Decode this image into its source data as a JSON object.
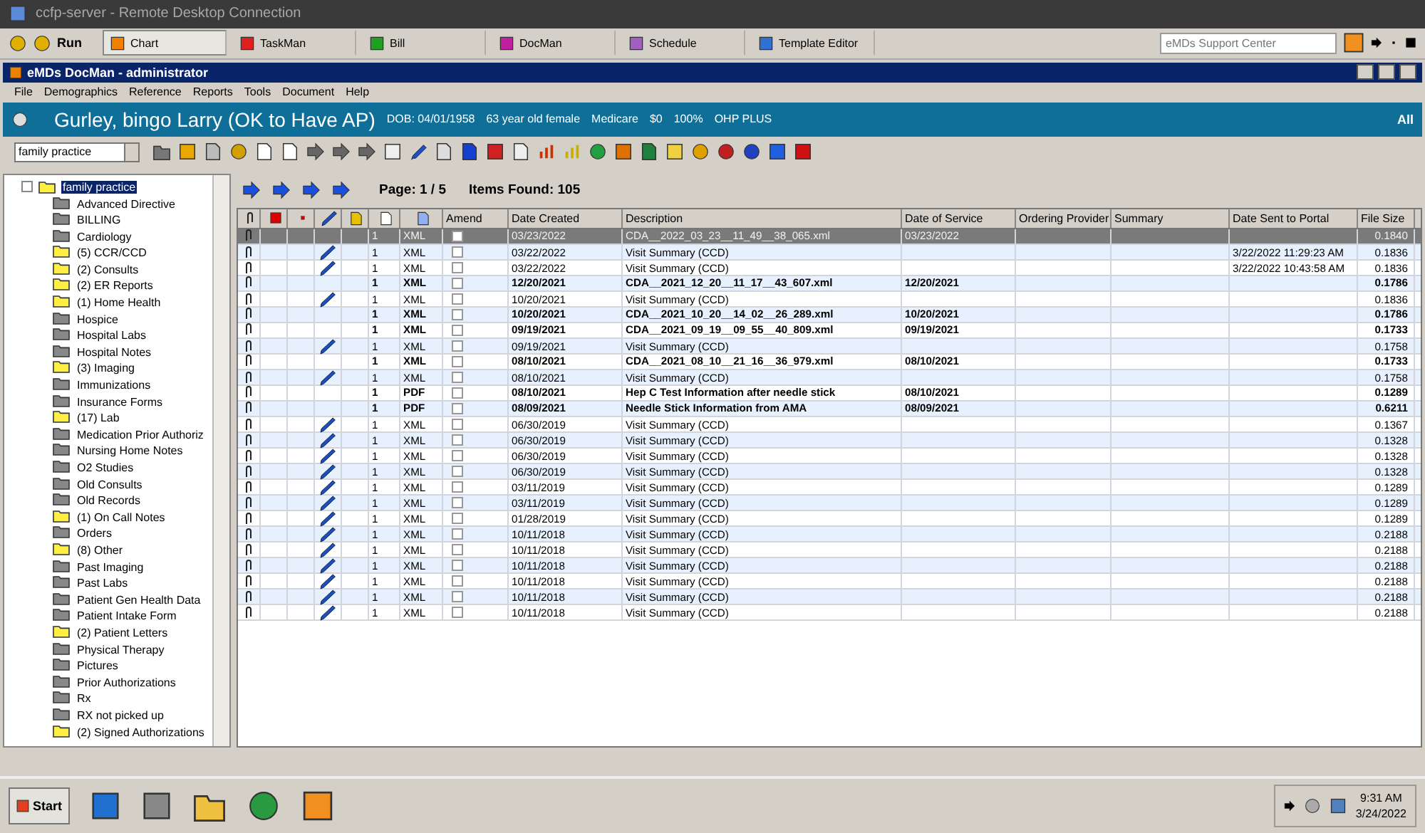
{
  "remote_window": {
    "title": "ccfp-server - Remote Desktop Connection"
  },
  "launcher": {
    "run_label": "Run",
    "tabs": [
      {
        "label": "Chart",
        "selected": true
      },
      {
        "label": "TaskMan",
        "selected": false
      },
      {
        "label": "Bill",
        "selected": false
      },
      {
        "label": "DocMan",
        "selected": false
      },
      {
        "label": "Schedule",
        "selected": false
      },
      {
        "label": "Template Editor",
        "selected": false
      }
    ],
    "search": {
      "placeholder": "eMDs Support Center"
    }
  },
  "window": {
    "title": "eMDs DocMan - administrator"
  },
  "menu": [
    "File",
    "Demographics",
    "Reference",
    "Reports",
    "Tools",
    "Document",
    "Help"
  ],
  "patient": {
    "name": "Gurley, bingo Larry (OK to Have AP)",
    "details": [
      "DOB: 04/01/1958",
      "63 year old female",
      "Medicare",
      "$0",
      "100%",
      "OHP PLUS"
    ],
    "filter": "All"
  },
  "toolbar": {
    "category": "family practice"
  },
  "tree": {
    "label": "family practice",
    "selected": true,
    "expanded": true,
    "children": [
      {
        "label": "Advanced Directive",
        "has_items": false
      },
      {
        "label": "BILLING",
        "has_items": false
      },
      {
        "label": "Cardiology",
        "has_items": false
      },
      {
        "label": "(5)  CCR/CCD",
        "has_items": true
      },
      {
        "label": "(2)  Consults",
        "has_items": true
      },
      {
        "label": "(2)  ER Reports",
        "has_items": true
      },
      {
        "label": "(1)  Home Health",
        "has_items": true
      },
      {
        "label": "Hospice",
        "has_items": false
      },
      {
        "label": "Hospital Labs",
        "has_items": false
      },
      {
        "label": "Hospital Notes",
        "has_items": false
      },
      {
        "label": "(3)  Imaging",
        "has_items": true
      },
      {
        "label": "Immunizations",
        "has_items": false
      },
      {
        "label": "Insurance Forms",
        "has_items": false
      },
      {
        "label": "(17)  Lab",
        "has_items": true
      },
      {
        "label": "Medication Prior Authoriz",
        "has_items": false
      },
      {
        "label": "Nursing Home Notes",
        "has_items": false
      },
      {
        "label": "O2 Studies",
        "has_items": false
      },
      {
        "label": "Old Consults",
        "has_items": false
      },
      {
        "label": "Old Records",
        "has_items": false
      },
      {
        "label": "(1)  On Call Notes",
        "has_items": true
      },
      {
        "label": "Orders",
        "has_items": false
      },
      {
        "label": "(8)  Other",
        "has_items": true
      },
      {
        "label": "Past Imaging",
        "has_items": false
      },
      {
        "label": "Past Labs",
        "has_items": false
      },
      {
        "label": "Patient Gen Health Data",
        "has_items": false
      },
      {
        "label": "Patient Intake Form",
        "has_items": false
      },
      {
        "label": "(2)  Patient Letters",
        "has_items": true
      },
      {
        "label": "Physical Therapy",
        "has_items": false
      },
      {
        "label": "Pictures",
        "has_items": false
      },
      {
        "label": "Prior Authorizations",
        "has_items": false
      },
      {
        "label": "Rx",
        "has_items": false
      },
      {
        "label": "RX not picked up",
        "has_items": false
      },
      {
        "label": "(2)  Signed Authorizations",
        "has_items": true
      }
    ]
  },
  "pager": {
    "page": "Page: 1 / 5",
    "found": "Items Found: 105"
  },
  "table": {
    "columns": [
      "Amend",
      "Date Created",
      "Description",
      "Date of Service",
      "Ordering Provider",
      "Summary",
      "Date Sent to Portal",
      "File Size"
    ],
    "rows": [
      {
        "selected": true,
        "bold": false,
        "edited": false,
        "count": "1",
        "format": "XML",
        "amend": false,
        "date_created": "03/23/2022",
        "description": "CDA__2022_03_23__11_49__38_065.xml",
        "date_of_service": "03/23/2022",
        "file_size": "0.1840"
      },
      {
        "selected": false,
        "bold": false,
        "edited": true,
        "count": "1",
        "format": "XML",
        "amend": false,
        "date_created": "03/22/2022",
        "description": "Visit Summary (CCD)",
        "date_sent": "3/22/2022 11:29:23 AM",
        "file_size": "0.1836"
      },
      {
        "selected": false,
        "bold": false,
        "edited": true,
        "count": "1",
        "format": "XML",
        "amend": false,
        "date_created": "03/22/2022",
        "description": "Visit Summary (CCD)",
        "date_sent": "3/22/2022 10:43:58 AM",
        "file_size": "0.1836"
      },
      {
        "selected": false,
        "bold": true,
        "edited": false,
        "count": "1",
        "format": "XML",
        "amend": false,
        "date_created": "12/20/2021",
        "description": "CDA__2021_12_20__11_17__43_607.xml",
        "date_of_service": "12/20/2021",
        "file_size": "0.1786"
      },
      {
        "selected": false,
        "bold": false,
        "edited": true,
        "count": "1",
        "format": "XML",
        "amend": false,
        "date_created": "10/20/2021",
        "description": "Visit Summary (CCD)",
        "file_size": "0.1836"
      },
      {
        "selected": false,
        "bold": true,
        "edited": false,
        "count": "1",
        "format": "XML",
        "amend": false,
        "date_created": "10/20/2021",
        "description": "CDA__2021_10_20__14_02__26_289.xml",
        "date_of_service": "10/20/2021",
        "file_size": "0.1786"
      },
      {
        "selected": false,
        "bold": true,
        "edited": false,
        "count": "1",
        "format": "XML",
        "amend": false,
        "date_created": "09/19/2021",
        "description": "CDA__2021_09_19__09_55__40_809.xml",
        "date_of_service": "09/19/2021",
        "file_size": "0.1733"
      },
      {
        "selected": false,
        "bold": false,
        "edited": true,
        "count": "1",
        "format": "XML",
        "amend": false,
        "date_created": "09/19/2021",
        "description": "Visit Summary (CCD)",
        "file_size": "0.1758"
      },
      {
        "selected": false,
        "bold": true,
        "edited": false,
        "count": "1",
        "format": "XML",
        "amend": false,
        "date_created": "08/10/2021",
        "description": "CDA__2021_08_10__21_16__36_979.xml",
        "date_of_service": "08/10/2021",
        "file_size": "0.1733"
      },
      {
        "selected": false,
        "bold": false,
        "edited": true,
        "count": "1",
        "format": "XML",
        "amend": false,
        "date_created": "08/10/2021",
        "description": "Visit Summary (CCD)",
        "file_size": "0.1758"
      },
      {
        "selected": false,
        "bold": true,
        "edited": false,
        "count": "1",
        "format": "PDF",
        "amend": false,
        "date_created": "08/10/2021",
        "description": "Hep C Test Information after needle stick",
        "date_of_service": "08/10/2021",
        "file_size": "0.1289"
      },
      {
        "selected": false,
        "bold": true,
        "edited": false,
        "count": "1",
        "format": "PDF",
        "amend": false,
        "date_created": "08/09/2021",
        "description": "Needle Stick Information from AMA",
        "date_of_service": "08/09/2021",
        "file_size": "0.6211"
      },
      {
        "selected": false,
        "bold": false,
        "edited": true,
        "count": "1",
        "format": "XML",
        "amend": false,
        "date_created": "06/30/2019",
        "description": "Visit Summary (CCD)",
        "file_size": "0.1367"
      },
      {
        "selected": false,
        "bold": false,
        "edited": true,
        "count": "1",
        "format": "XML",
        "amend": false,
        "date_created": "06/30/2019",
        "description": "Visit Summary (CCD)",
        "file_size": "0.1328"
      },
      {
        "selected": false,
        "bold": false,
        "edited": true,
        "count": "1",
        "format": "XML",
        "amend": false,
        "date_created": "06/30/2019",
        "description": "Visit Summary (CCD)",
        "file_size": "0.1328"
      },
      {
        "selected": false,
        "bold": false,
        "edited": true,
        "count": "1",
        "format": "XML",
        "amend": false,
        "date_created": "06/30/2019",
        "description": "Visit Summary (CCD)",
        "file_size": "0.1328"
      },
      {
        "selected": false,
        "bold": false,
        "edited": true,
        "count": "1",
        "format": "XML",
        "amend": false,
        "date_created": "03/11/2019",
        "description": "Visit Summary (CCD)",
        "file_size": "0.1289"
      },
      {
        "selected": false,
        "bold": false,
        "edited": true,
        "count": "1",
        "format": "XML",
        "amend": false,
        "date_created": "03/11/2019",
        "description": "Visit Summary (CCD)",
        "file_size": "0.1289"
      },
      {
        "selected": false,
        "bold": false,
        "edited": true,
        "count": "1",
        "format": "XML",
        "amend": false,
        "date_created": "01/28/2019",
        "description": "Visit Summary (CCD)",
        "file_size": "0.1289"
      },
      {
        "selected": false,
        "bold": false,
        "edited": true,
        "count": "1",
        "format": "XML",
        "amend": false,
        "date_created": "10/11/2018",
        "description": "Visit Summary (CCD)",
        "file_size": "0.2188"
      },
      {
        "selected": false,
        "bold": false,
        "edited": true,
        "count": "1",
        "format": "XML",
        "amend": false,
        "date_created": "10/11/2018",
        "description": "Visit Summary (CCD)",
        "file_size": "0.2188"
      },
      {
        "selected": false,
        "bold": false,
        "edited": true,
        "count": "1",
        "format": "XML",
        "amend": false,
        "date_created": "10/11/2018",
        "description": "Visit Summary (CCD)",
        "file_size": "0.2188"
      },
      {
        "selected": false,
        "bold": false,
        "edited": true,
        "count": "1",
        "format": "XML",
        "amend": false,
        "date_created": "10/11/2018",
        "description": "Visit Summary (CCD)",
        "file_size": "0.2188"
      },
      {
        "selected": false,
        "bold": false,
        "edited": true,
        "count": "1",
        "format": "XML",
        "amend": false,
        "date_created": "10/11/2018",
        "description": "Visit Summary (CCD)",
        "file_size": "0.2188"
      },
      {
        "selected": false,
        "bold": false,
        "edited": true,
        "count": "1",
        "format": "XML",
        "amend": false,
        "date_created": "10/11/2018",
        "description": "Visit Summary (CCD)",
        "file_size": "0.2188"
      }
    ]
  },
  "taskbar": {
    "start": "Start",
    "time": "9:31 AM",
    "date": "3/24/2022"
  }
}
